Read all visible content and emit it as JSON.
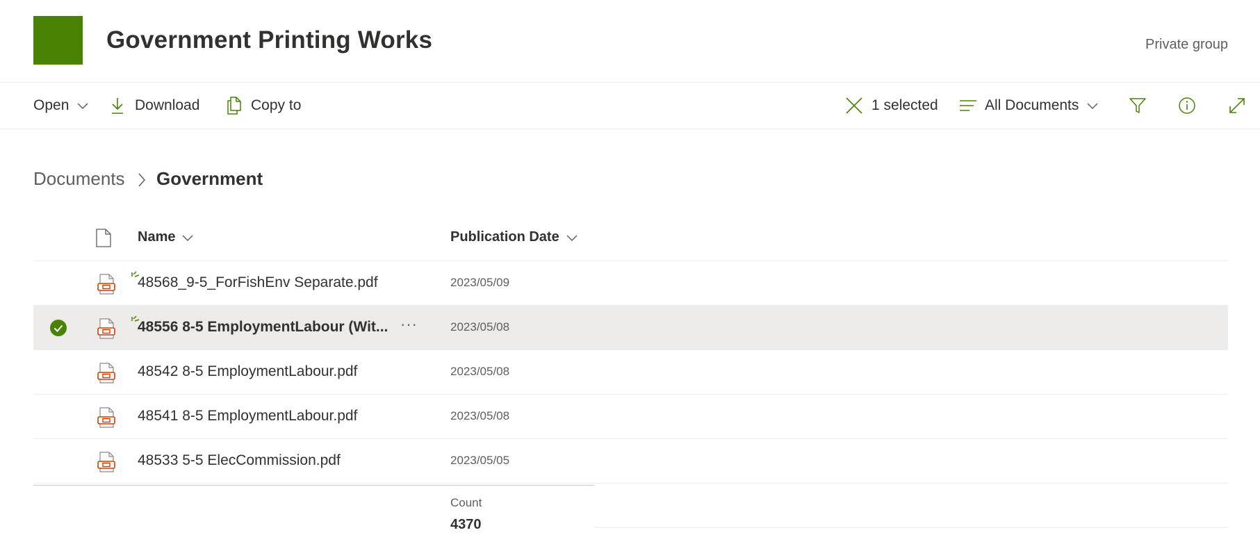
{
  "colors": {
    "accent": "#498205",
    "pdf": "#d83b01",
    "text": "#323130",
    "muted": "#605e5c",
    "selected_row": "#edebe9"
  },
  "header": {
    "site_title": "Government Printing Works",
    "group_label": "Private group"
  },
  "commandbar": {
    "open_label": "Open",
    "download_label": "Download",
    "copy_label": "Copy to",
    "selected_label": "1 selected",
    "view_label": "All Documents"
  },
  "breadcrumb": {
    "root": "Documents",
    "current": "Government"
  },
  "list": {
    "columns": {
      "name": "Name",
      "date": "Publication Date"
    },
    "rows": [
      {
        "name": "48568_9-5_ForFishEnv Separate.pdf",
        "date": "2023/05/09",
        "selected": false,
        "new": true
      },
      {
        "name": "48556 8-5 EmploymentLabour (Wit...",
        "date": "2023/05/08",
        "selected": true,
        "new": true
      },
      {
        "name": "48542 8-5 EmploymentLabour.pdf",
        "date": "2023/05/08",
        "selected": false,
        "new": false
      },
      {
        "name": "48541 8-5 EmploymentLabour.pdf",
        "date": "2023/05/08",
        "selected": false,
        "new": false
      },
      {
        "name": "48533 5-5 ElecCommission.pdf",
        "date": "2023/05/05",
        "selected": false,
        "new": false
      }
    ],
    "footer": {
      "count_label": "Count",
      "count_value": "4370"
    }
  }
}
